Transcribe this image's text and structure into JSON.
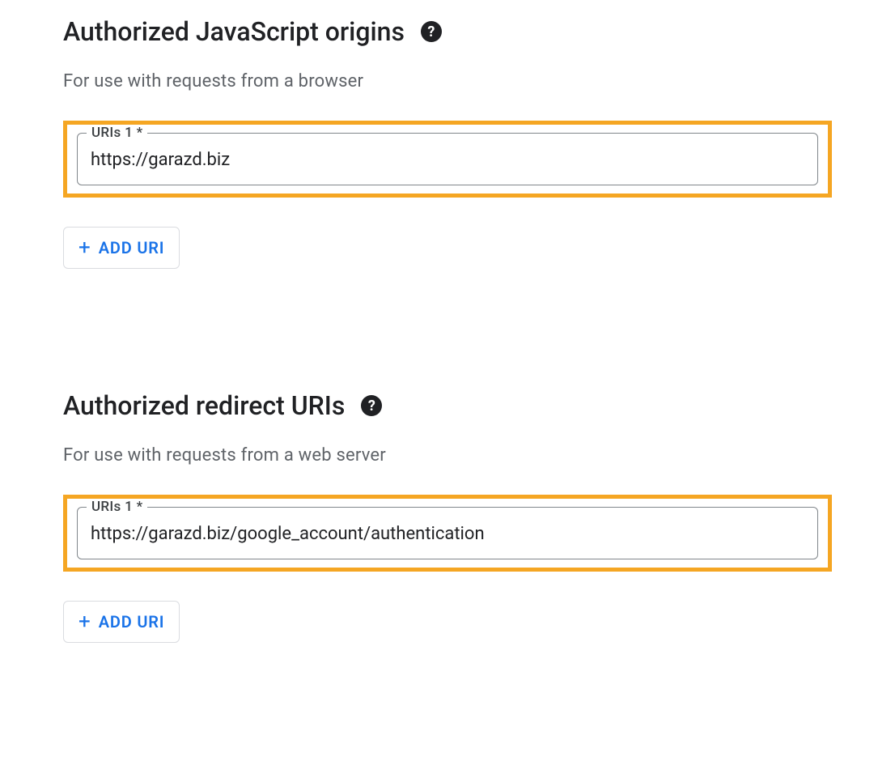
{
  "sections": {
    "js_origins": {
      "title": "Authorized JavaScript origins",
      "description": "For use with requests from a browser",
      "field_label": "URIs 1 *",
      "field_value": "https://garazd.biz",
      "add_button_label": "ADD URI"
    },
    "redirect_uris": {
      "title": "Authorized redirect URIs",
      "description": "For use with requests from a web server",
      "field_label": "URIs 1 *",
      "field_value": "https://garazd.biz/google_account/authentication",
      "add_button_label": "ADD URI"
    }
  }
}
